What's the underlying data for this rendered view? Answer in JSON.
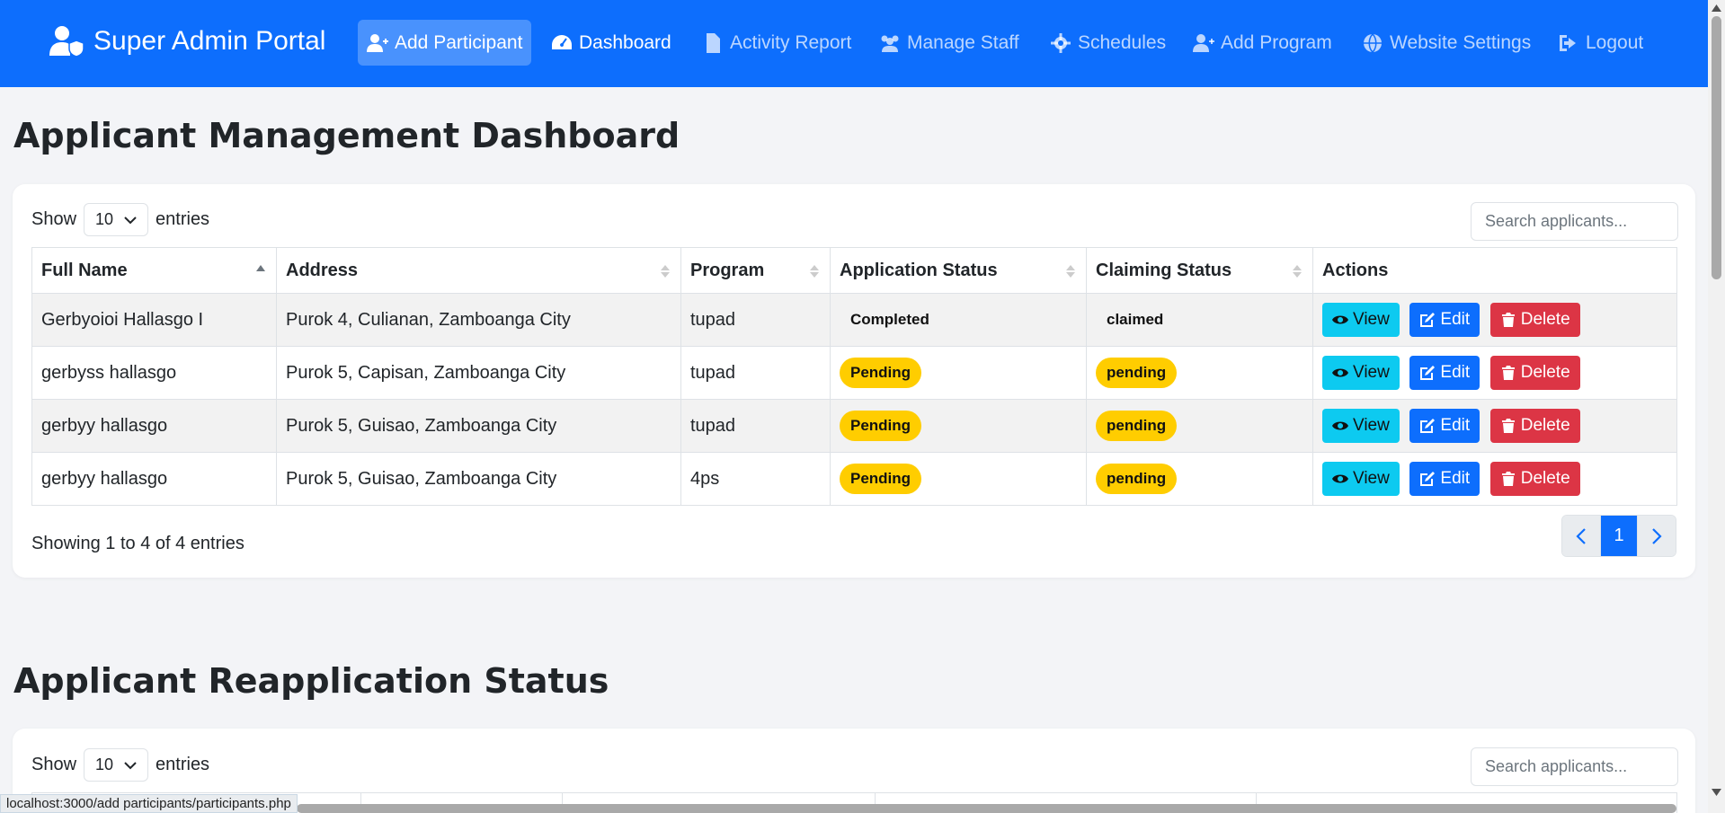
{
  "brand": {
    "title": "Super Admin Portal",
    "icon": "user-shield-icon"
  },
  "nav": [
    {
      "label": "Add Participant",
      "icon": "user-plus-icon"
    },
    {
      "label": "Dashboard",
      "icon": "gauge-icon"
    },
    {
      "label": "Activity Report",
      "icon": "file-icon"
    },
    {
      "label": "Manage Staff",
      "icon": "users-icon"
    },
    {
      "label": "Schedules",
      "icon": "gear-icon"
    },
    {
      "label": "Add Program",
      "icon": "user-plus-icon"
    },
    {
      "label": "Website Settings",
      "icon": "globe-icon"
    },
    {
      "label": "Logout",
      "icon": "logout-icon"
    }
  ],
  "dashboard": {
    "title": "Applicant Management Dashboard",
    "length": {
      "show": "Show",
      "value": "10",
      "entries": "entries"
    },
    "search_placeholder": "Search applicants...",
    "columns": [
      "Full Name",
      "Address",
      "Program",
      "Application Status",
      "Claiming Status",
      "Actions"
    ],
    "rows": [
      {
        "name": "Gerbyoioi Hallasgo I",
        "address": "Purok 4, Culianan, Zamboanga City",
        "program": "tupad",
        "app_status": "Completed",
        "claim_status": "claimed"
      },
      {
        "name": "gerbyss hallasgo",
        "address": "Purok 5, Capisan, Zamboanga City",
        "program": "tupad",
        "app_status": "Pending",
        "claim_status": "pending"
      },
      {
        "name": "gerbyy hallasgo",
        "address": "Purok 5, Guisao, Zamboanga City",
        "program": "tupad",
        "app_status": "Pending",
        "claim_status": "pending"
      },
      {
        "name": "gerbyy hallasgo",
        "address": "Purok 5, Guisao, Zamboanga City",
        "program": "4ps",
        "app_status": "Pending",
        "claim_status": "pending"
      }
    ],
    "actions": {
      "view": "View",
      "edit": "Edit",
      "delete": "Delete"
    },
    "info": "Showing 1 to 4 of 4 entries",
    "page": "1"
  },
  "reapplication": {
    "title": "Applicant Reapplication Status",
    "length": {
      "show": "Show",
      "value": "10",
      "entries": "entries"
    },
    "search_placeholder": "Search applicants..."
  },
  "status_url": "localhost:3000/add participants/participants.php",
  "colors": {
    "primary": "#0d6efd",
    "info": "#0dcaf0",
    "danger": "#dc3545",
    "warning": "#ffcd00"
  }
}
